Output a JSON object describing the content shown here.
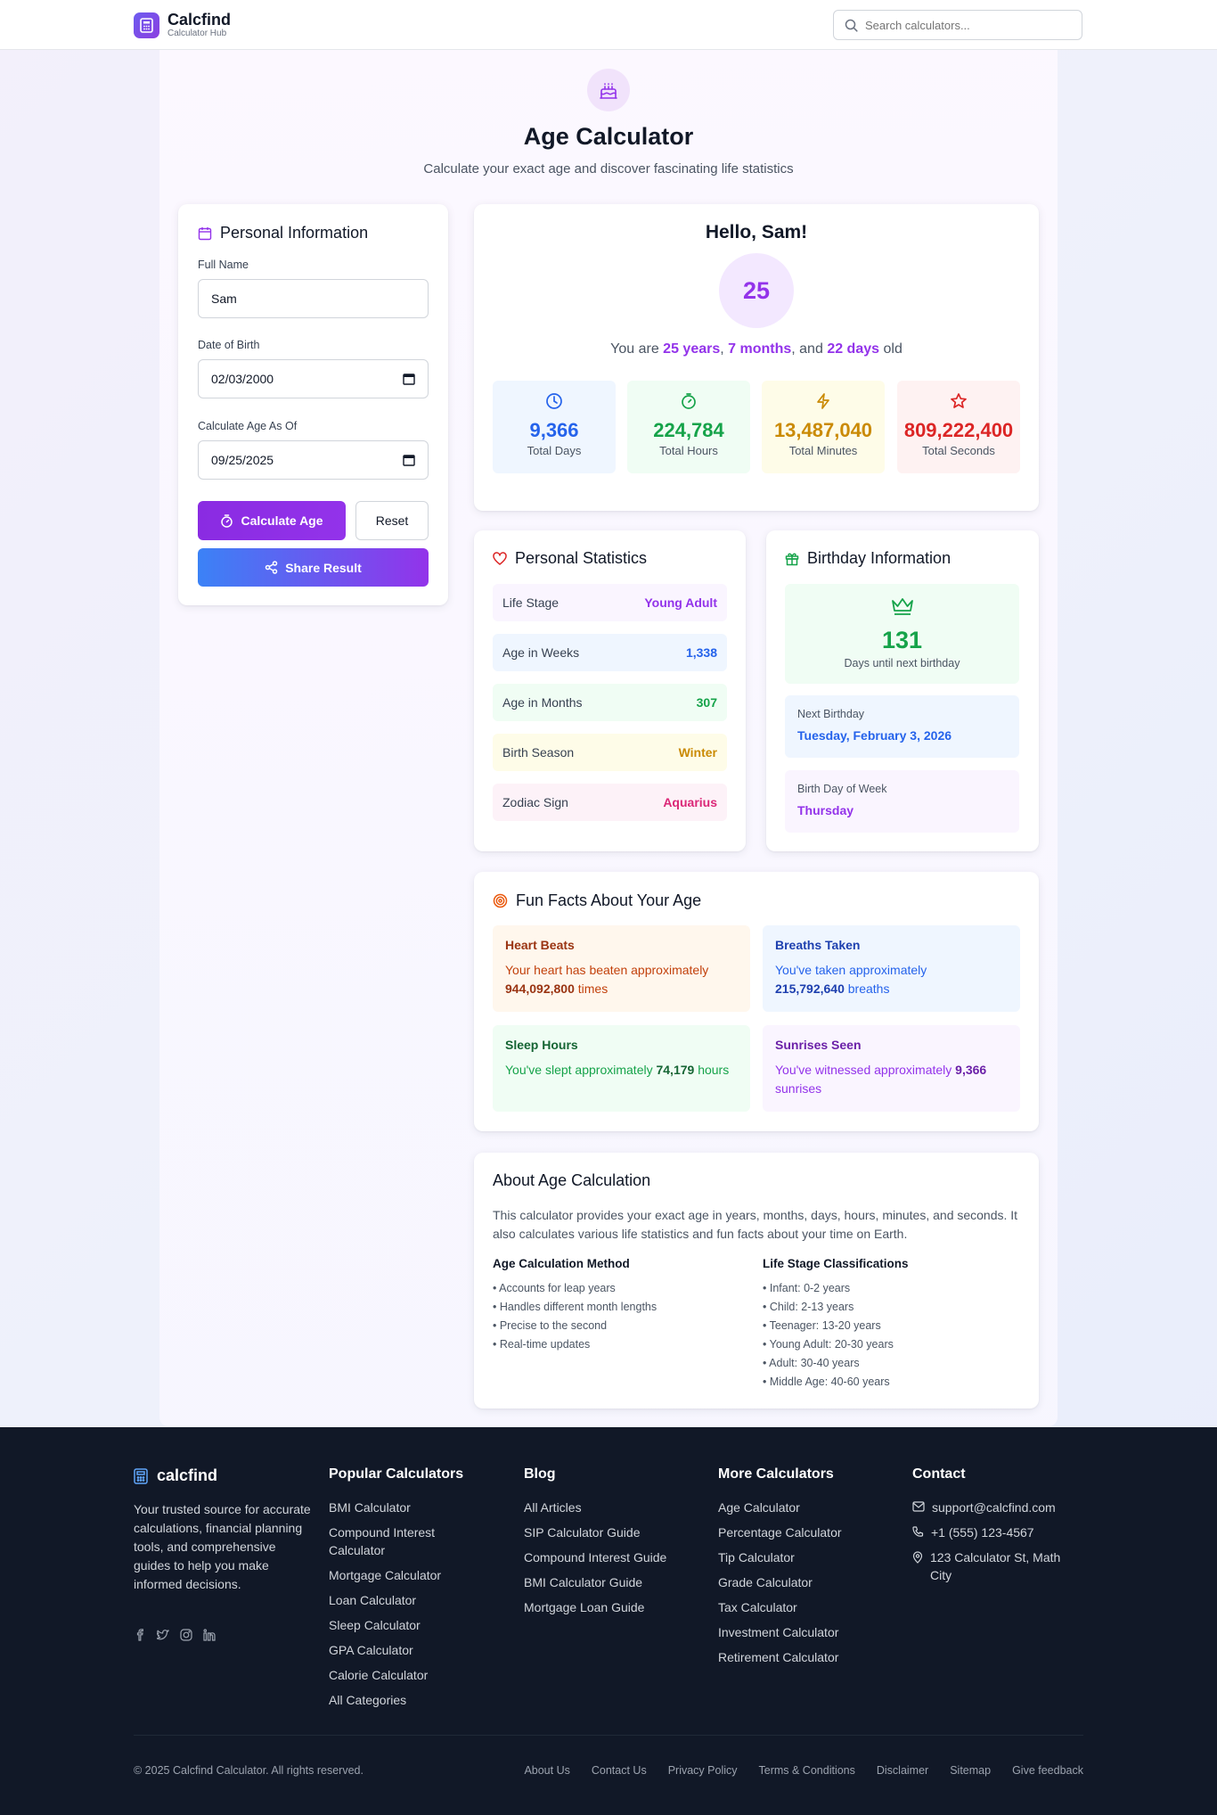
{
  "header": {
    "brand_name": "Calcfind",
    "brand_tagline": "Calculator Hub",
    "search_placeholder": "Search calculators..."
  },
  "hero": {
    "title": "Age Calculator",
    "subtitle": "Calculate your exact age and discover fascinating life statistics"
  },
  "form": {
    "title": "Personal Information",
    "name_label": "Full Name",
    "name_value": "Sam",
    "dob_label": "Date of Birth",
    "dob_value": "02/03/2000",
    "asof_label": "Calculate Age As Of",
    "asof_value": "09/25/2025",
    "calculate_label": "Calculate Age",
    "reset_label": "Reset",
    "share_label": "Share Result"
  },
  "result": {
    "greeting": "Hello, Sam!",
    "age_years_big": "25",
    "age_prefix": "You are",
    "years": "25 years",
    "comma1": ",",
    "months": "7 months",
    "and": ", and",
    "days": "22 days",
    "age_suffix": "old",
    "stats": [
      {
        "value": "9,366",
        "label": "Total Days",
        "color": "#2563eb",
        "bg": "#eff6ff",
        "icon": "clock-icon"
      },
      {
        "value": "224,784",
        "label": "Total Hours",
        "color": "#16a34a",
        "bg": "#f0fdf4",
        "icon": "timer-icon"
      },
      {
        "value": "13,487,040",
        "label": "Total Minutes",
        "color": "#ca8a04",
        "bg": "#fefce8",
        "icon": "lightning-icon"
      },
      {
        "value": "809,222,400",
        "label": "Total Seconds",
        "color": "#dc2626",
        "bg": "#fef2f2",
        "icon": "star-icon"
      }
    ]
  },
  "personal_stats": {
    "title": "Personal Statistics",
    "rows": [
      {
        "label": "Life Stage",
        "value": "Young Adult",
        "color": "#9333ea",
        "bg": "#faf5ff"
      },
      {
        "label": "Age in Weeks",
        "value": "1,338",
        "color": "#2563eb",
        "bg": "#eff6ff"
      },
      {
        "label": "Age in Months",
        "value": "307",
        "color": "#16a34a",
        "bg": "#f0fdf4"
      },
      {
        "label": "Birth Season",
        "value": "Winter",
        "color": "#ca8a04",
        "bg": "#fefce8"
      },
      {
        "label": "Zodiac Sign",
        "value": "Aquarius",
        "color": "#db2777",
        "bg": "#fdf2f8"
      }
    ]
  },
  "birthday": {
    "title": "Birthday Information",
    "days_until": "131",
    "days_until_label": "Days until next birthday",
    "next_label": "Next Birthday",
    "next_value": "Tuesday, February 3, 2026",
    "dow_label": "Birth Day of Week",
    "dow_value": "Thursday"
  },
  "fun_facts": {
    "title": "Fun Facts About Your Age",
    "heart": {
      "title": "Heart Beats",
      "pre": "Your heart has beaten approximately",
      "value": "944,092,800",
      "post": "times"
    },
    "breaths": {
      "title": "Breaths Taken",
      "pre": "You've taken approximately",
      "value": "215,792,640",
      "post": "breaths"
    },
    "sleep": {
      "title": "Sleep Hours",
      "pre": "You've slept approximately",
      "value": "74,179",
      "post": "hours"
    },
    "sunrises": {
      "title": "Sunrises Seen",
      "pre": "You've witnessed approximately",
      "value": "9,366",
      "post": "sunrises"
    }
  },
  "about": {
    "title": "About Age Calculation",
    "paragraph": "This calculator provides your exact age in years, months, days, hours, minutes, and seconds. It also calculates various life statistics and fun facts about your time on Earth.",
    "method_title": "Age Calculation Method",
    "method_items": [
      "• Accounts for leap years",
      "• Handles different month lengths",
      "• Precise to the second",
      "• Real-time updates"
    ],
    "stages_title": "Life Stage Classifications",
    "stages_items": [
      "• Infant: 0-2 years",
      "• Child: 2-13 years",
      "• Teenager: 13-20 years",
      "• Young Adult: 20-30 years",
      "• Adult: 30-40 years",
      "• Middle Age: 40-60 years"
    ]
  },
  "footer": {
    "brand": "calcfind",
    "description": "Your trusted source for accurate calculations, financial planning tools, and comprehensive guides to help you make informed decisions.",
    "popular_title": "Popular Calculators",
    "popular": [
      "BMI Calculator",
      "Compound Interest Calculator",
      "Mortgage Calculator",
      "Loan Calculator",
      "Sleep Calculator",
      "GPA Calculator",
      "Calorie Calculator",
      "All Categories"
    ],
    "blog_title": "Blog",
    "blog": [
      "All Articles",
      "SIP Calculator Guide",
      "Compound Interest Guide",
      "BMI Calculator Guide",
      "Mortgage Loan Guide"
    ],
    "more_title": "More Calculators",
    "more": [
      "Age Calculator",
      "Percentage Calculator",
      "Tip Calculator",
      "Grade Calculator",
      "Tax Calculator",
      "Investment Calculator",
      "Retirement Calculator"
    ],
    "contact_title": "Contact",
    "email": "support@calcfind.com",
    "phone": "+1 (555) 123-4567",
    "address": "123 Calculator St, Math City",
    "copyright": "© 2025 Calcfind Calculator. All rights reserved.",
    "links": [
      "About Us",
      "Contact Us",
      "Privacy Policy",
      "Terms & Conditions",
      "Disclaimer",
      "Sitemap",
      "Give feedback"
    ]
  }
}
